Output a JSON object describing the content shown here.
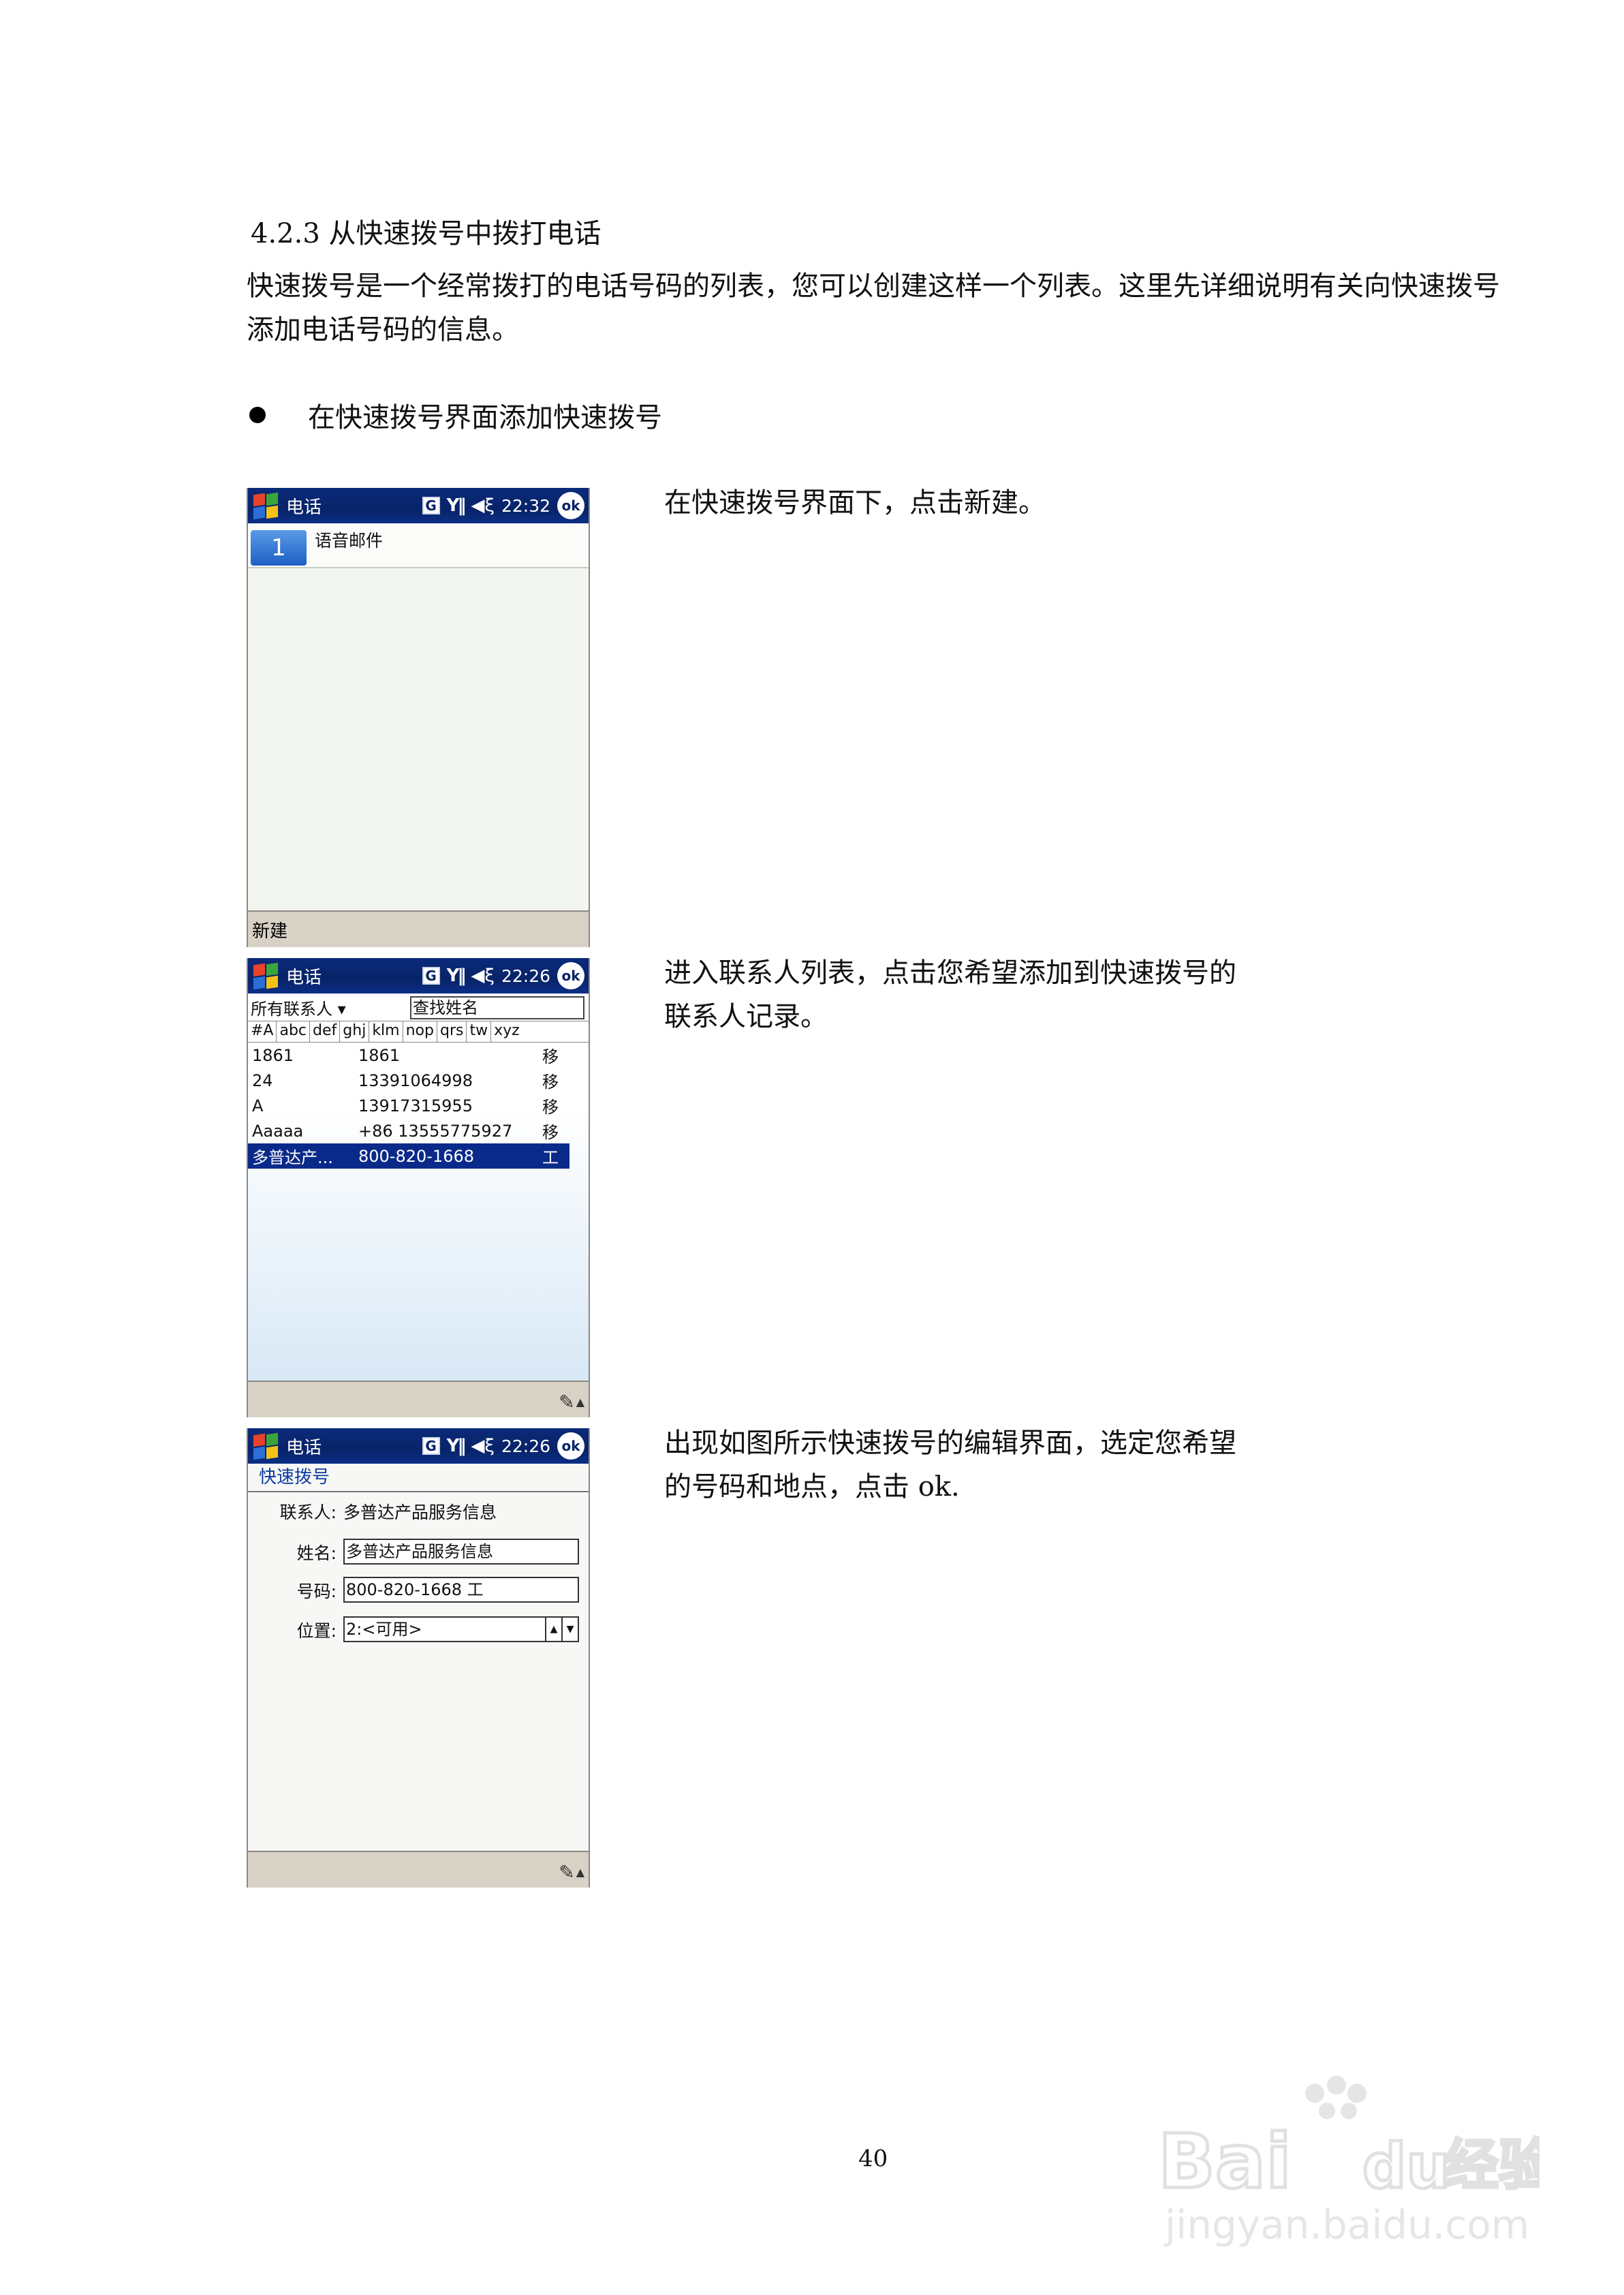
{
  "document": {
    "section_heading": "4.2.3 从快速拨号中拨打电话",
    "intro": "快速拨号是一个经常拨打的电话号码的列表，您可以创建这样一个列表。这里先详细说明有关向快速拨号添加电话号码的信息。",
    "bullet": "在快速拨号界面添加快速拨号",
    "steps": [
      "在快速拨号界面下，点击新建。",
      "进入联系人列表，点击您希望添加到快速拨号的联系人记录。",
      "出现如图所示快速拨号的编辑界面，选定您希望的号码和地点，点击 ok."
    ],
    "page_number": "40"
  },
  "screens": {
    "s1": {
      "app_title": "电话",
      "time": "22:32",
      "ok": "ok",
      "g": "G",
      "speed_dial": {
        "number": "1",
        "label": "语音邮件"
      },
      "cmd_new": "新建"
    },
    "s2": {
      "app_title": "电话",
      "time": "22:26",
      "ok": "ok",
      "g": "G",
      "filter": "所有联系人 ▾",
      "search_placeholder": "查找姓名",
      "tabs": [
        "#A",
        "abc",
        "def",
        "ghj",
        "klm",
        "nop",
        "qrs",
        "tw",
        "xyz"
      ],
      "contacts": [
        {
          "name": "1861",
          "number": "1861",
          "type": "移"
        },
        {
          "name": "24",
          "number": "13391064998",
          "type": "移"
        },
        {
          "name": "A",
          "number": "13917315955",
          "type": "移"
        },
        {
          "name": "Aaaaa",
          "number": "+86 13555775927",
          "type": "移"
        },
        {
          "name": "多普达产...",
          "number": "800-820-1668",
          "type": "工"
        }
      ]
    },
    "s3": {
      "app_title": "电话",
      "time": "22:26",
      "ok": "ok",
      "g": "G",
      "header": "快速拨号",
      "contact_label": "联系人:",
      "contact_value": "多普达产品服务信息",
      "name_label": "姓名:",
      "name_value": "多普达产品服务信息",
      "number_label": "号码:",
      "number_value": "800-820-1668 工",
      "location_label": "位置:",
      "location_value": "2:<可用>"
    }
  },
  "watermark": {
    "brand": "Bai du 经验",
    "url": "jingyan.baidu.com"
  },
  "colors": {
    "titlebar": "#082368",
    "selection": "#0a2a8a",
    "cmdbar": "#d8d2c6"
  }
}
